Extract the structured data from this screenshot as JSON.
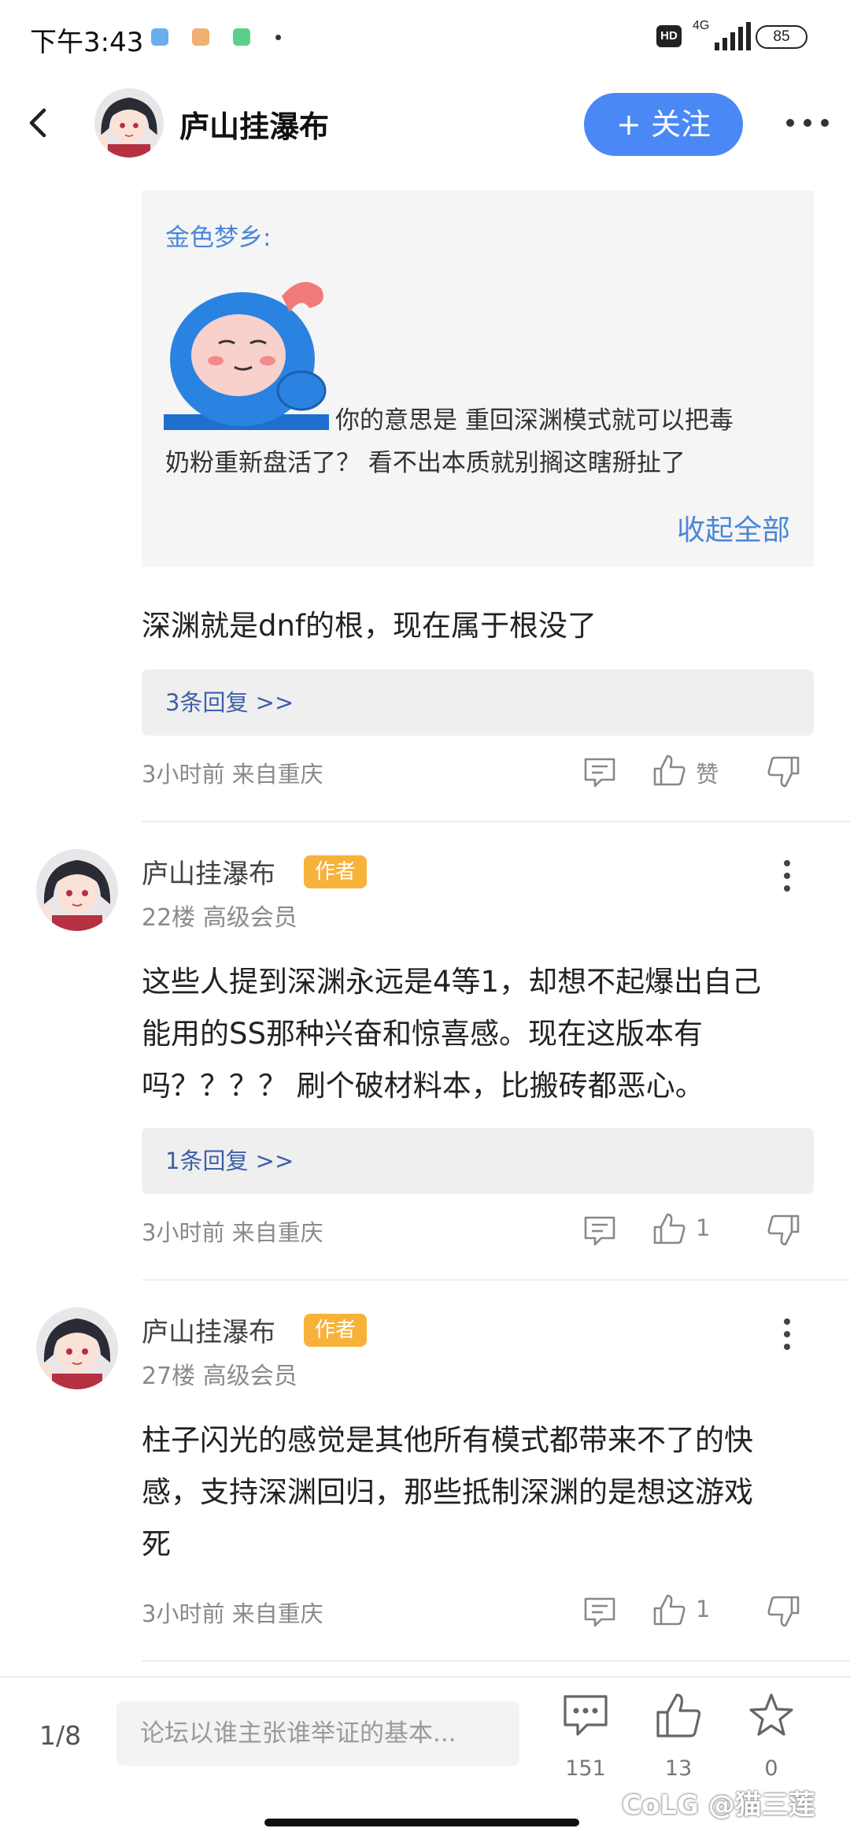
{
  "status_bar": {
    "time": "下午3:43",
    "network": "4G",
    "hd": "HD",
    "battery": "85"
  },
  "header": {
    "title": "庐山挂瀑布",
    "follow_label": "+ 关注"
  },
  "quote": {
    "author": "金色梦乡:",
    "text_line1": "你的意思是 重回深渊模式就可以把毒",
    "text_line2": "奶粉重新盘活了？ 看不出本质就别搁这瞎掰扯了",
    "collapse_label": "收起全部"
  },
  "comments": [
    {
      "text": "深渊就是dnf的根，现在属于根没了",
      "replies": "3条回复 >>",
      "meta": "3小时前 来自重庆",
      "likes": "赞"
    },
    {
      "name": "庐山挂瀑布",
      "badge": "作者",
      "floor": "22楼 高级会员",
      "text_lines": [
        "这些人提到深渊永远是4等1，却想不起爆出自己",
        "能用的SS那种兴奋和惊喜感。现在这版本有",
        "吗？？？？ 刷个破材料本，比搬砖都恶心。"
      ],
      "replies": "1条回复 >>",
      "meta": "3小时前 来自重庆",
      "likes": "1"
    },
    {
      "name": "庐山挂瀑布",
      "badge": "作者",
      "floor": "27楼 高级会员",
      "text_lines": [
        "柱子闪光的感觉是其他所有模式都带来不了的快",
        "感，支持深渊回归，那些抵制深渊的是想这游戏",
        "死"
      ],
      "meta": "3小时前 来自重庆",
      "likes": "1"
    }
  ],
  "bottom_bar": {
    "page": "1/8",
    "input_placeholder": "论坛以谁主张谁举证的基本...",
    "comments_count": "151",
    "likes_count": "13",
    "favorites_count": "0"
  },
  "watermark": "CoLG @猫三莲",
  "colors": {
    "accent": "#4a88f5",
    "link": "#4a86d8",
    "badge": "#f7b23a",
    "reply_text": "#3e5fa8"
  }
}
